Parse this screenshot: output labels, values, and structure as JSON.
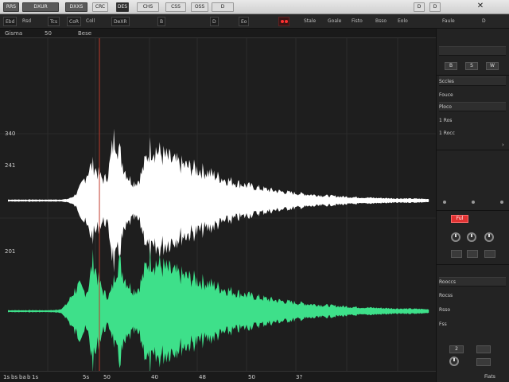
{
  "titlebar": {
    "buttons": [
      "RRS",
      "DXUR",
      "DXXS",
      "CRC",
      "DES",
      "CHS",
      "CSS",
      "OSS",
      "D",
      "D",
      "D"
    ],
    "close": "✕"
  },
  "toolbar": {
    "items": [
      "Ebd",
      "Rsd",
      "Tcs",
      "CoR",
      "Coll",
      "DeXR",
      "B",
      "D",
      "Eo",
      "Stale",
      "Goale",
      "Fisto",
      "Bsso",
      "Eolo",
      "Faule",
      "D"
    ]
  },
  "ruler": {
    "labels": [
      "Gisma",
      "50",
      "Bese"
    ]
  },
  "left_axis": {
    "labels": [
      "340",
      "241",
      "201"
    ]
  },
  "bottom_axis": {
    "labels": [
      "1s",
      "bs",
      "ba",
      "b",
      "1s",
      "5s",
      "50",
      "40",
      "48",
      "50",
      "3?",
      "0",
      "1",
      "Fiats"
    ]
  },
  "panel": {
    "rows": [
      "Sccles",
      "Fouce",
      "Ploco",
      "1 Ros",
      "1 Rocc",
      "Rooccs",
      "Rocss",
      "Rsso",
      "Fss"
    ],
    "red_button": "Ful",
    "small": [
      "B",
      "S",
      "W",
      "2"
    ]
  },
  "colors": {
    "background": "#1e1e1e",
    "waveform_top": "#ffffff",
    "waveform_bottom": "#3ee08a",
    "playhead": "#c0392b",
    "accent_red": "#e03232"
  }
}
